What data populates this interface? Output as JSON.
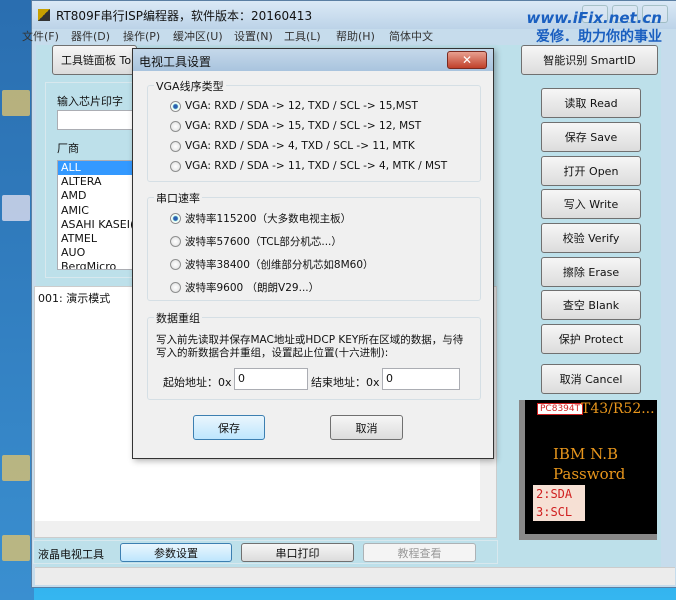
{
  "window": {
    "title": "RT809F串行ISP编程器，软件版本：20160413",
    "watermark_line1": "www.iFix.net.cn",
    "watermark_line2": "爱修．助力你的事业"
  },
  "menu": [
    "文件(F)",
    "器件(D)",
    "操作(P)",
    "缓冲区(U)",
    "设置(N)",
    "工具(L)",
    "帮助(H)",
    "简体中文"
  ],
  "top_buttons": {
    "toolchain": "工具链面板 To",
    "smartid": "智能识别 SmartID"
  },
  "left": {
    "chip_label": "输入芯片印字",
    "chip_value": "",
    "vendor_label": "厂商",
    "vendors": [
      "ALL",
      "ALTERA",
      "AMD",
      "AMIC",
      "ASAHI KASEI(",
      "ATMEL",
      "AUO",
      "BergMicro"
    ]
  },
  "log": {
    "text": "001:  演示模式"
  },
  "actions": [
    "读取 Read",
    "保存 Save",
    "打开 Open",
    "写入 Write",
    "校验 Verify",
    "擦除 Erase",
    "查空 Blank",
    "保护 Protect"
  ],
  "cancel": "取消 Cancel",
  "chip_image": {
    "tag": "PC8394T",
    "model": "T43/R52...",
    "line1": "IBM  N.B",
    "line2": "Password",
    "pin1": "2:SDA",
    "pin2": "3:SCL"
  },
  "bottom": {
    "label": "液晶电视工具",
    "btn_params": "参数设置",
    "btn_serial": "串口打印",
    "btn_tutorial": "教程查看"
  },
  "dialog": {
    "title": "电视工具设置",
    "vga": {
      "label": "VGA线序类型",
      "options": [
        "VGA: RXD / SDA -> 12, TXD / SCL -> 15,MST",
        "VGA: RXD / SDA -> 15, TXD / SCL -> 12, MST",
        "VGA: RXD / SDA ->   4, TXD / SCL -> 11, MTK",
        "VGA: RXD / SDA -> 11, TXD / SCL ->   4, MTK / MST"
      ],
      "selected": 0
    },
    "baud": {
      "label": "串口速率",
      "options": [
        "波特率115200（大多数电视主板）",
        "波特率57600（TCL部分机芯...）",
        "波特率38400（创维部分机芯如8M60）",
        "波特率9600 （朗朗V29...）"
      ],
      "selected": 0
    },
    "regroup": {
      "label": "数据重组",
      "desc1": "写入前先读取并保存MAC地址或HDCP KEY所在区域的数据，与待",
      "desc2": "写入的新数据合并重组，设置起止位置(十六进制):",
      "start_label": "起始地址：0x",
      "start_value": "0",
      "end_label": "结束地址：0x",
      "end_value": "0"
    },
    "save": "保存",
    "cancel": "取消"
  }
}
